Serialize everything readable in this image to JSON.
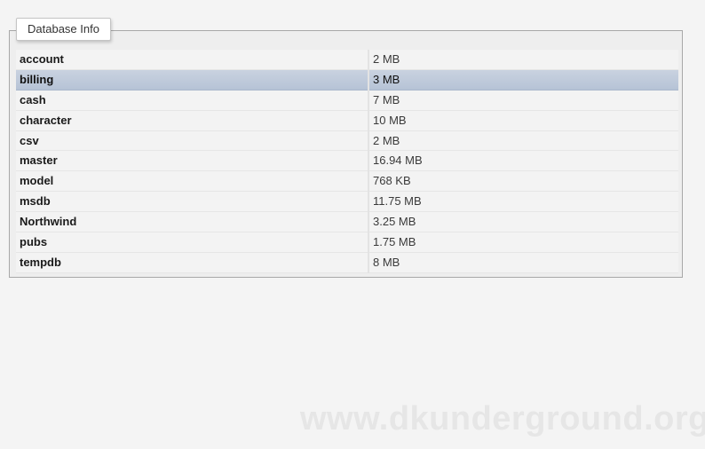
{
  "panel": {
    "title": "Database Info"
  },
  "databases": [
    {
      "name": "account",
      "size": "2 MB"
    },
    {
      "name": "billing",
      "size": "3 MB"
    },
    {
      "name": "cash",
      "size": "7 MB"
    },
    {
      "name": "character",
      "size": "10 MB"
    },
    {
      "name": "csv",
      "size": "2 MB"
    },
    {
      "name": "master",
      "size": "16.94 MB"
    },
    {
      "name": "model",
      "size": "768 KB"
    },
    {
      "name": "msdb",
      "size": "11.75 MB"
    },
    {
      "name": "Northwind",
      "size": "3.25 MB"
    },
    {
      "name": "pubs",
      "size": "1.75 MB"
    },
    {
      "name": "tempdb",
      "size": "8 MB"
    }
  ],
  "selected_row": "billing",
  "colors": {
    "selection": "#bfcadb",
    "panel_background": "#eeeeee",
    "page_background": "#f4f4f4"
  },
  "watermark": "www.dkunderground.org"
}
